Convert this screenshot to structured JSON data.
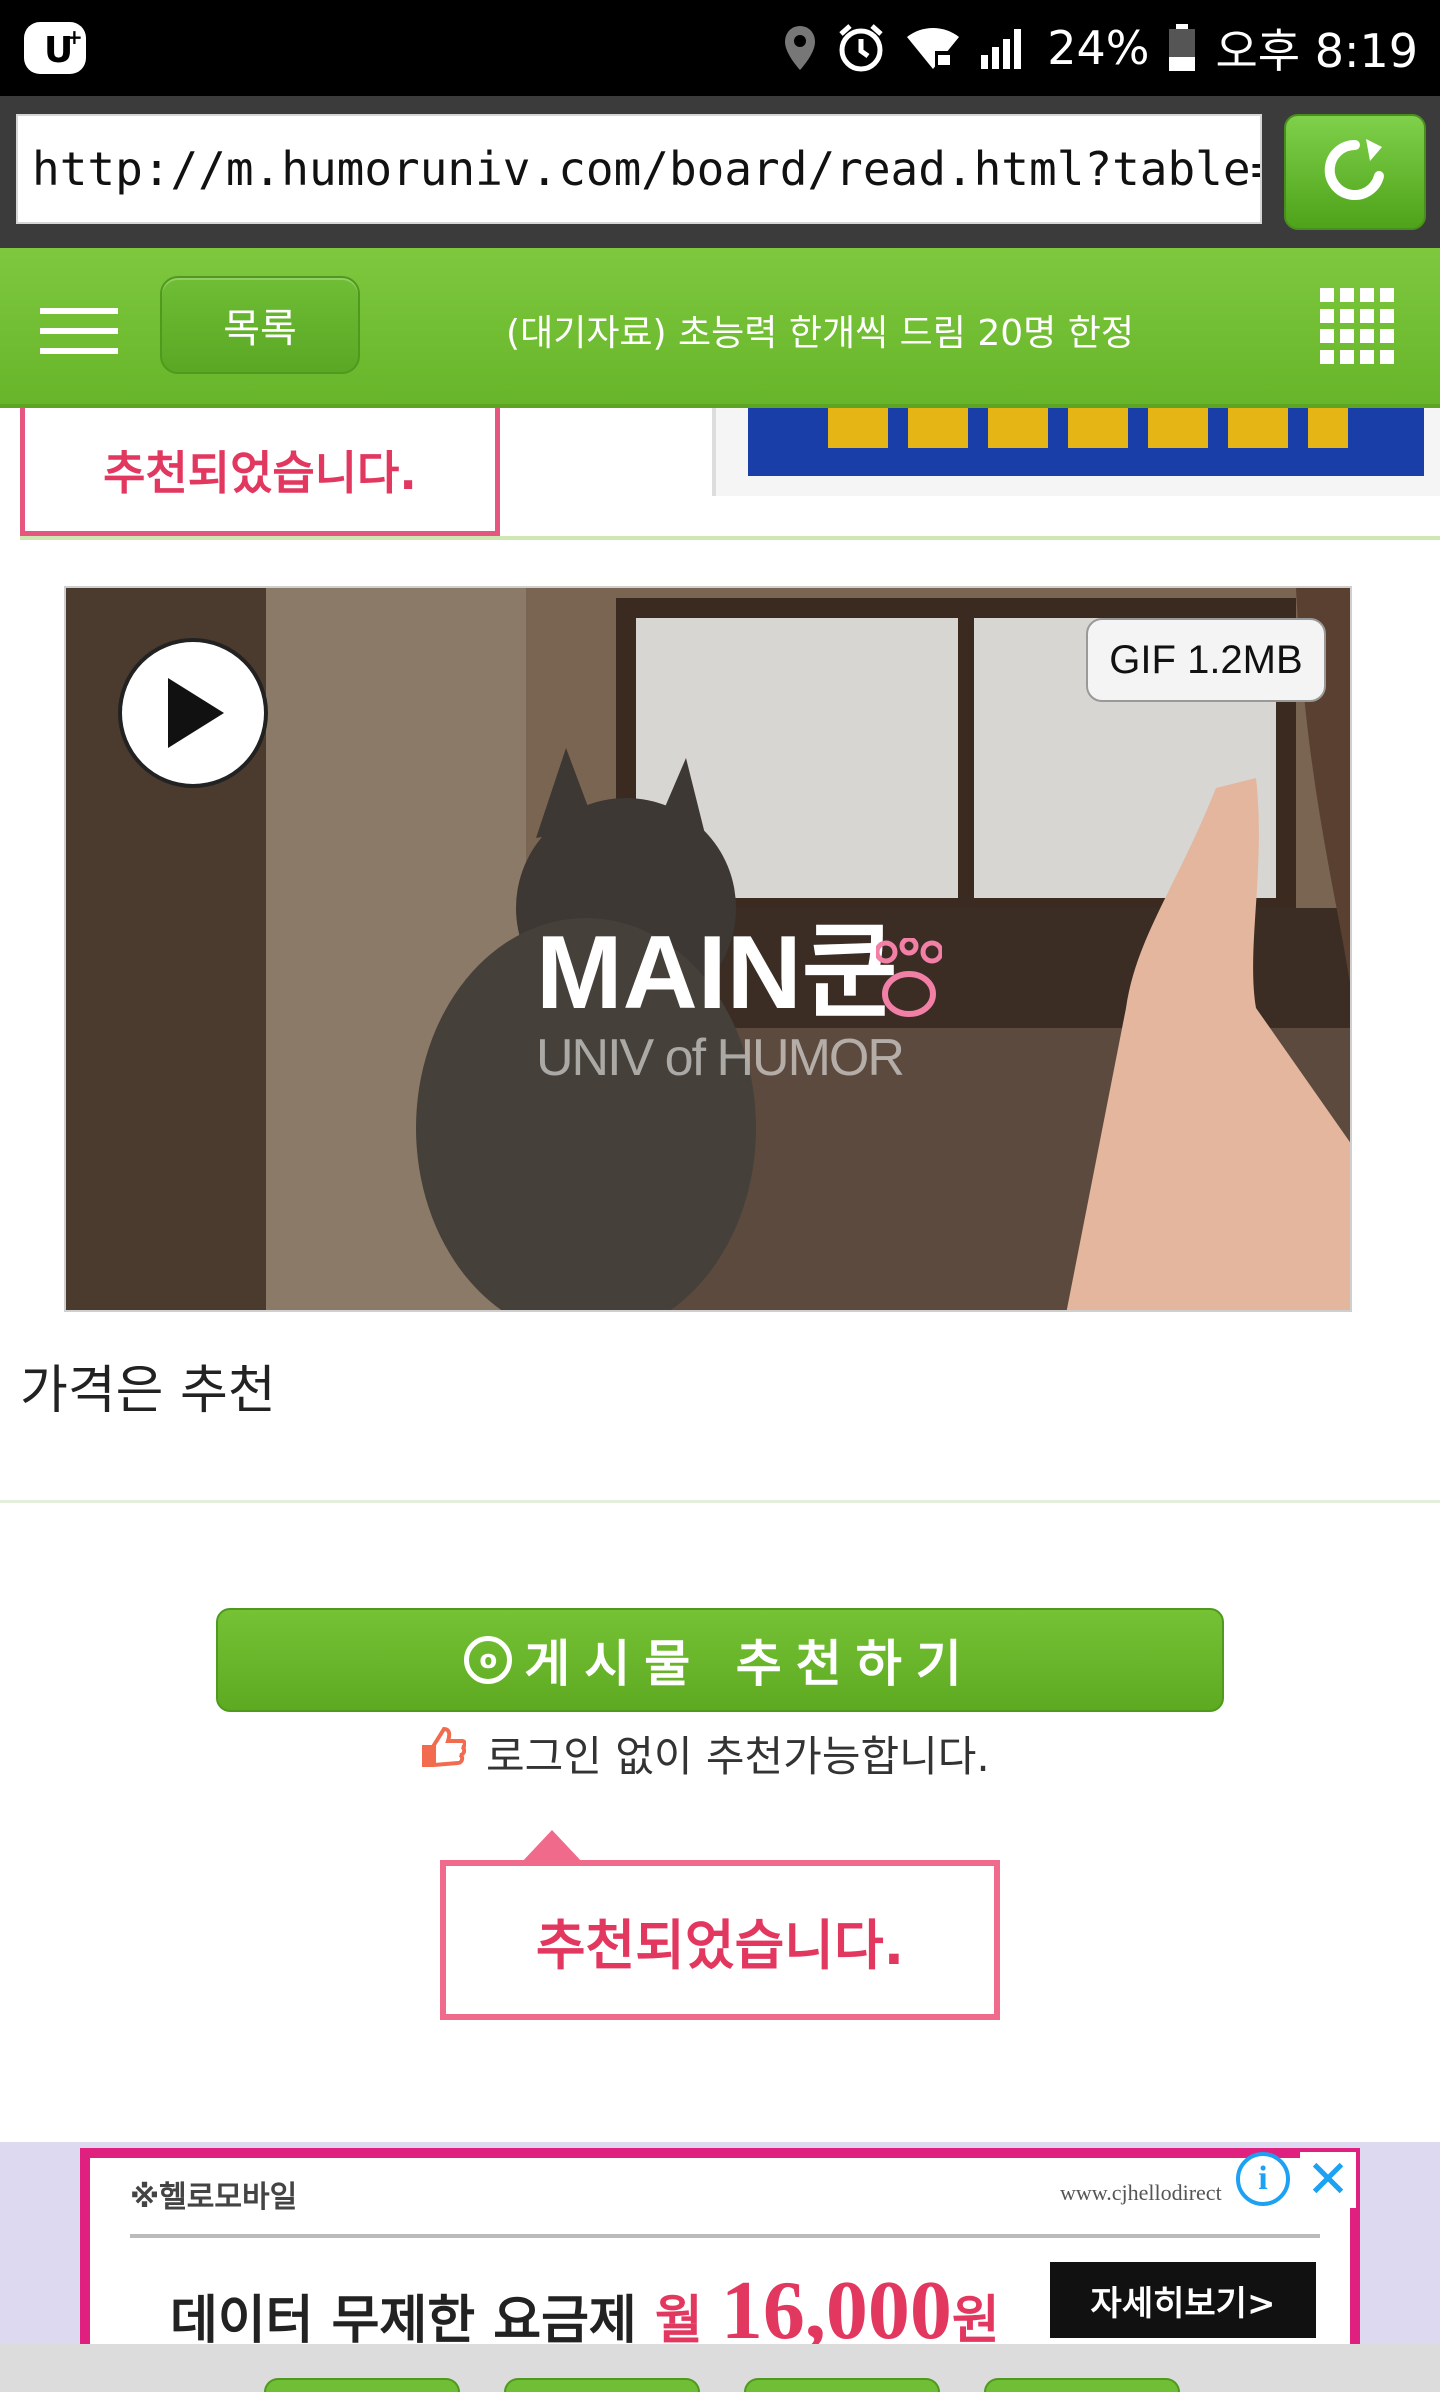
{
  "status_bar": {
    "battery": "24%",
    "time_label": "오후 8:19"
  },
  "browser": {
    "url": "http://m.humoruniv.com/board/read.html?table=pds&number=..."
  },
  "header": {
    "list_label": "목록",
    "title": "(대기자료) 초능력 한개씩 드림 20명 한정"
  },
  "top_notice": {
    "recommended_text": "추천되었습니다."
  },
  "gif": {
    "badge": "GIF 1.2MB",
    "watermark_main": "MAIN쿤",
    "watermark_sub": "UNIV of HUMOR"
  },
  "post": {
    "caption": "가격은 추천"
  },
  "recommend": {
    "button_label": "게시물 추천하기",
    "button_icon_char": "o",
    "login_note": "로그인 없이 추천가능합니다.",
    "recommended_text": "추천되었습니다."
  },
  "ad": {
    "brand": "※헬로모바일",
    "url": "www.cjhellodirect",
    "headline_pre": "데이터 무제한 요금제 ",
    "won_label": "월 ",
    "price": "16,000",
    "won_suffix": "원",
    "cta": "자세히보기>",
    "info_label": "i",
    "close_label": "✕"
  },
  "colors": {
    "header_green": "#72c136",
    "accent_pink": "#e2375f",
    "ad_magenta": "#e0207f"
  }
}
